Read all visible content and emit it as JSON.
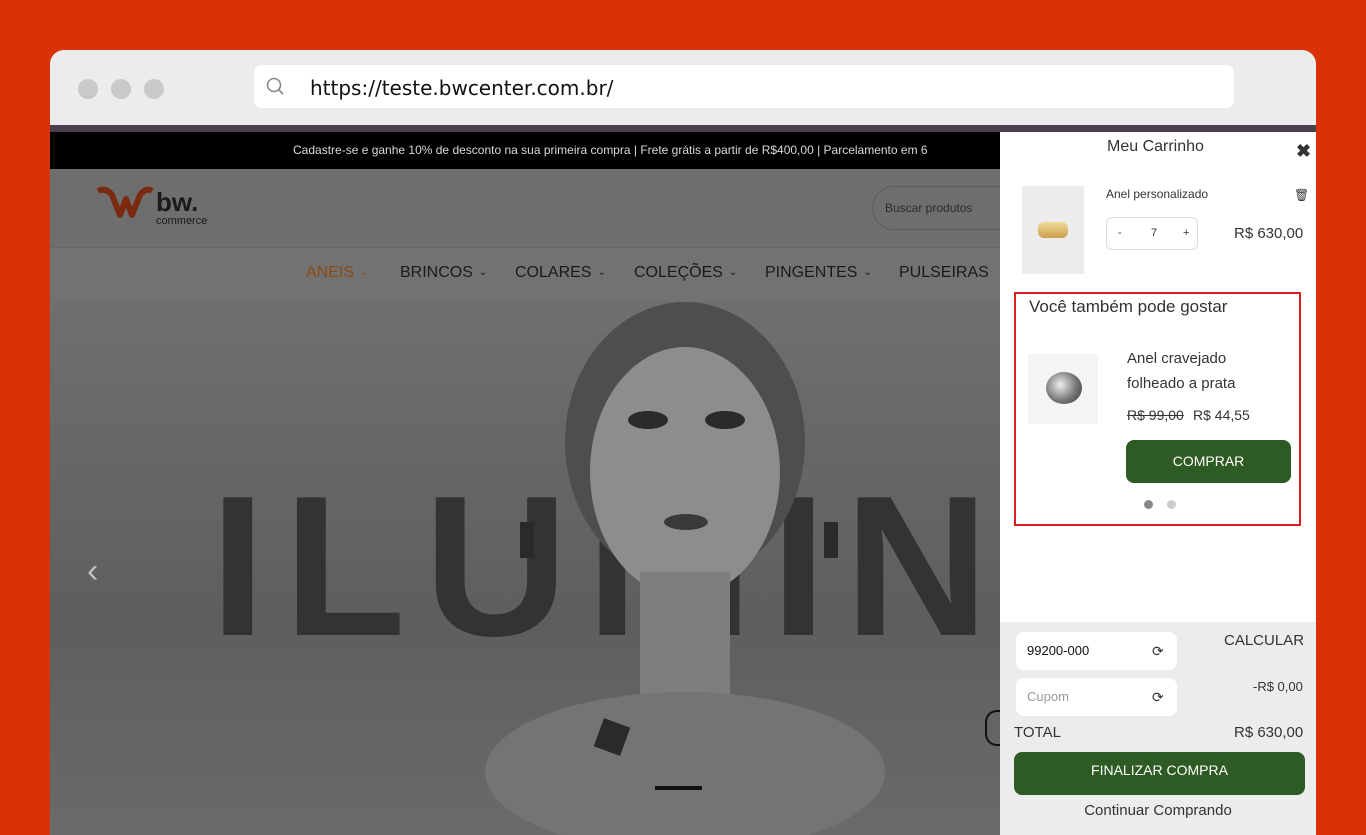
{
  "browser": {
    "url": "https://teste.bwcenter.com.br/"
  },
  "topbar": {
    "announcement": "Cadastre-se e ganhe 10% de desconto na sua primeira compra | Frete grátis a partir de R$400,00 | Parcelamento em 6"
  },
  "header": {
    "logo_main": "bw.",
    "logo_sub": "commerce",
    "search_placeholder": "Buscar produtos"
  },
  "nav": {
    "items": [
      {
        "label": "ANEIS",
        "has_dropdown": true,
        "active": true
      },
      {
        "label": "BRINCOS",
        "has_dropdown": true
      },
      {
        "label": "COLARES",
        "has_dropdown": true
      },
      {
        "label": "COLEÇÕES",
        "has_dropdown": true
      },
      {
        "label": "PINGENTES",
        "has_dropdown": true
      },
      {
        "label": "PULSEIRAS",
        "has_dropdown": false
      }
    ]
  },
  "hero": {
    "word": "ILUMINA",
    "prev_icon": "chevron-left-icon"
  },
  "cart": {
    "title": "Meu Carrinho",
    "close_icon": "close-icon",
    "line": {
      "name": "Anel personalizado",
      "qty_minus": "-",
      "qty": "7",
      "qty_plus": "+",
      "price": "R$ 630,00",
      "delete_icon": "trash-icon"
    },
    "upsell": {
      "title": "Você também pode gostar",
      "product_name": "Anel cravejado folheado a prata",
      "old_price": "R$ 99,00",
      "new_price": "R$ 44,55",
      "buy_label": "COMPRAR",
      "pager_active_index": 0,
      "pager_count": 2
    },
    "footer": {
      "zip_value": "99200-000",
      "calc_label": "CALCULAR",
      "coupon_placeholder": "Cupom",
      "discount": "-R$ 0,00",
      "total_label": "TOTAL",
      "total_value": "R$ 630,00",
      "checkout_label": "FINALIZAR COMPRA",
      "continue_label": "Continuar Comprando"
    }
  },
  "colors": {
    "page_background": "#d93208",
    "primary_button": "#2e5a23",
    "highlight_border": "#d81e1e",
    "active_nav": "#8a4a12"
  }
}
